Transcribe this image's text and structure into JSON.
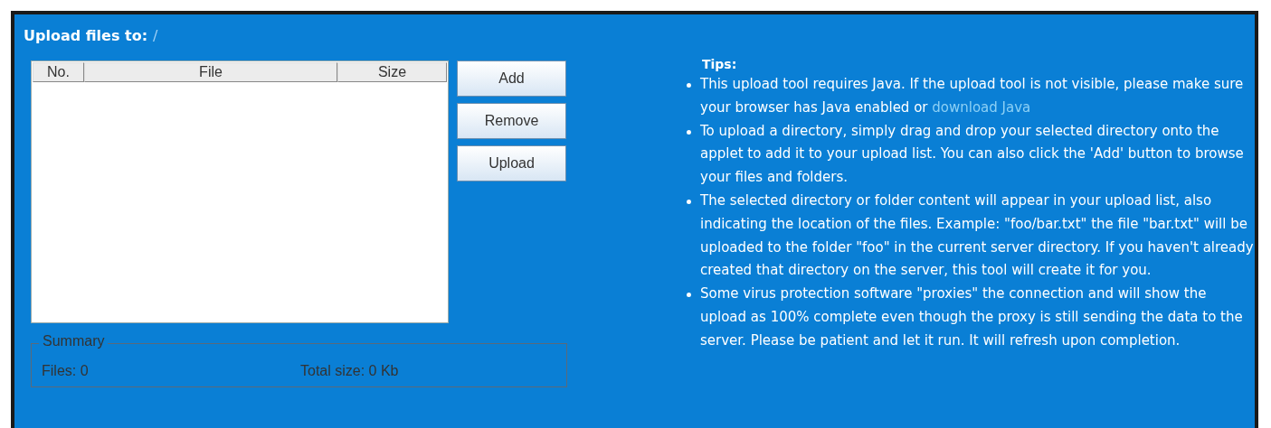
{
  "upload_target": {
    "label": "Upload files to:",
    "path": "/"
  },
  "file_table": {
    "columns": [
      "No.",
      "File",
      "Size"
    ]
  },
  "buttons": [
    "Add",
    "Remove",
    "Upload"
  ],
  "summary": {
    "title": "Summary",
    "files": "Files: 0",
    "total_size": "Total size: 0 Kb"
  },
  "tips": {
    "title": "Tips:",
    "items": [
      {
        "text": "This upload tool requires Java. If the upload tool is not visible, please make sure your browser has Java enabled or",
        "link": "download Java"
      },
      {
        "text": "To upload a directory, simply drag and drop your selected directory onto the applet to add it to your upload list. You can also click the 'Add' button to browse your files and folders."
      },
      {
        "text": "The selected directory or folder content will appear in your upload list, also indicating the location of the files. Example: \"foo/bar.txt\" the file \"bar.txt\" will be uploaded to the folder \"foo\" in the current server directory. If you haven't already created that directory on the server, this tool will create it for you."
      },
      {
        "text": "Some virus protection software \"proxies\" the connection and will show the upload as 100% complete even though the proxy is still sending the data to the server. Please be patient and let it run. It will refresh upon completion."
      }
    ]
  }
}
